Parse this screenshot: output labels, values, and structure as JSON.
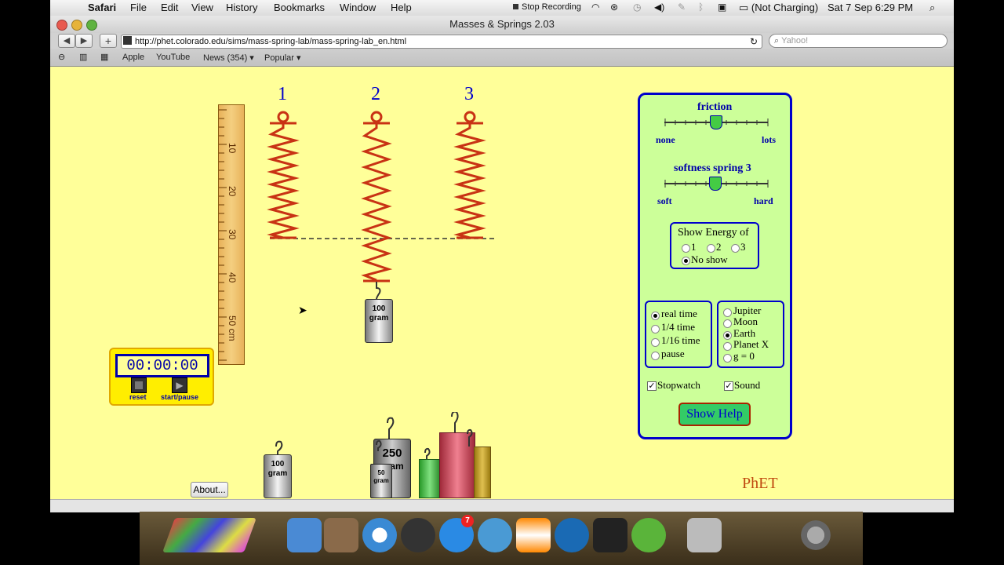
{
  "menubar": {
    "apple_icon": "apple-logo-icon",
    "app_name": "Safari",
    "menus": [
      "File",
      "Edit",
      "View",
      "History",
      "Bookmarks",
      "Window",
      "Help"
    ],
    "stop_recording": "Stop Recording",
    "battery": "(Not Charging)",
    "datetime": "Sat 7 Sep  6:29 PM"
  },
  "window": {
    "title": "Masses & Springs 2.03",
    "url": "http://phet.colorado.edu/sims/mass-spring-lab/mass-spring-lab_en.html",
    "search_placeholder": "Yahoo!",
    "bookmarks": [
      "Apple",
      "YouTube",
      "News (354) ▾",
      "Popular ▾"
    ]
  },
  "sim": {
    "spring_labels": [
      "1",
      "2",
      "3"
    ],
    "ruler_labels": [
      "10",
      "20",
      "30",
      "40",
      "50 cm"
    ],
    "hanging_mass": {
      "value": "100",
      "unit": "gram"
    },
    "floor_masses": [
      {
        "value": "100",
        "unit": "gram"
      },
      {
        "value": "250",
        "unit": "gram"
      },
      {
        "value": "50",
        "unit": "gram"
      }
    ],
    "stopwatch": {
      "time": "00:00:00",
      "reset": "reset",
      "start_pause": "start/pause"
    },
    "about_button": "About...",
    "logo": "PhET",
    "panel": {
      "friction_label": "friction",
      "friction_min": "none",
      "friction_max": "lots",
      "friction_level": 0.5,
      "softness_label": "softness spring 3",
      "softness_min": "soft",
      "softness_max": "hard",
      "softness_level": 0.5,
      "energy_title": "Show Energy of",
      "energy_options": [
        "1",
        "2",
        "3"
      ],
      "energy_none": "No show",
      "energy_selected": "No show",
      "time_options": [
        "real time",
        "1/4 time",
        "1/16 time",
        "pause"
      ],
      "time_selected": "real time",
      "gravity_options": [
        "Jupiter",
        "Moon",
        "Earth",
        "Planet X",
        "g = 0"
      ],
      "gravity_selected": "Earth",
      "stopwatch_label": "Stopwatch",
      "stopwatch_checked": true,
      "sound_label": "Sound",
      "sound_checked": true,
      "help_button": "Show Help"
    }
  },
  "dock": {
    "icons": [
      "chalk-icon",
      "finder-icon",
      "photo-icon",
      "safari-icon",
      "player-icon",
      "app-store-icon",
      "people-icon",
      "vlc-icon",
      "utility-icon",
      "game-icon",
      "utorrent-icon",
      "trash-icon",
      "gear-icon"
    ],
    "app_store_badge": "7"
  }
}
